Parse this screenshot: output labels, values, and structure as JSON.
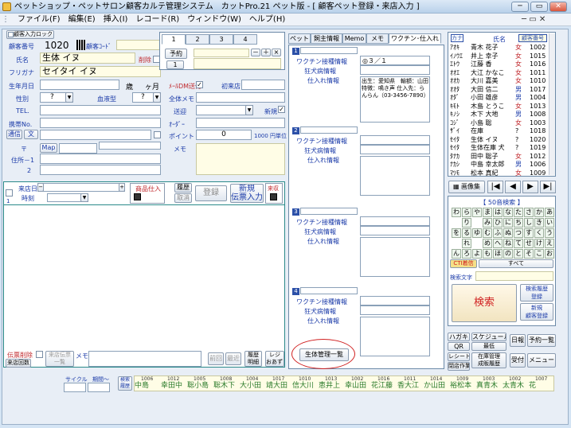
{
  "window": {
    "title": "ペットショップ・ペットサロン顧客カルテ管理システム　カットPro.21 ペット版 - [ 顧客ペット登録・来店入力 ]"
  },
  "menu": [
    "ファイル(F)",
    "編集(E)",
    "挿入(I)",
    "レコード(R)",
    "ウィンドウ(W)",
    "ヘルプ(H)"
  ],
  "customer": {
    "lock_label": "顧客入力ロック",
    "number_label": "顧客番号",
    "number_value": "1020",
    "code_label": "顧客ｺｰﾄﾞ",
    "name_label": "氏名",
    "name_value": "生体 イヌ",
    "delete_label": "削除",
    "furigana_label": "フリガナ",
    "furigana_value": "セイタイ イヌ",
    "birthday_label": "生年月日",
    "age_unit": "歳",
    "month_unit": "ヶ月",
    "dm_label": "ﾒｰﾙDM送付",
    "first_visit_label": "初来店",
    "sex_label": "性別",
    "sex_value": "?",
    "blood_label": "血液型",
    "blood_value": "?",
    "memo_label": "全体メモ",
    "tel_label": "TEL.",
    "send_label": "送迎",
    "new_label": "新規",
    "mobile_label": "携帯No.",
    "order_label": "ｵｰﾀﾞｰ",
    "mail_button": "通信",
    "text_button": "文",
    "point_label": "ポイント",
    "point_value": "0",
    "point_unit": "1000 円単位",
    "zip_label": "〒",
    "map_button": "Map",
    "memo2_label": "メモ",
    "address1_label": "住所－1",
    "address2_label": "2"
  },
  "tabs": {
    "items": [
      "1",
      "2",
      "3",
      "4"
    ],
    "reserve_button": "予約",
    "reserve_num": "1",
    "small_buttons": [
      "－",
      "＋",
      "×"
    ]
  },
  "visit": {
    "date_label": "来店日",
    "time_label": "時刻",
    "product_button": "商品仕入",
    "history_button": "履歴",
    "cancel_button": "取消",
    "register_button": "登録",
    "new_button_line1": "新規",
    "new_button_line2": "伝票入力",
    "receipt_button": "来収",
    "slip_delete": "伝票削除",
    "slip_list_line1": "来店伝票",
    "slip_list_line2": "一覧",
    "memo_label": "メモ",
    "visit_count_button": "来店回数",
    "prev_button": "前回",
    "recent_button": "最近",
    "detail_line1": "履歴",
    "detail_line2": "明細",
    "register_line1": "レジ",
    "register_line2": "おあずり"
  },
  "pet_tabs": [
    "ペット",
    "飼主情報",
    "Memo",
    "メモ",
    "ワクチン･仕入れ"
  ],
  "vaccine": {
    "sections": [
      {
        "num": "1",
        "vaccine_label": "ワクチン接種情報",
        "vaccine_value": "◎３／１",
        "disease_label": "狂犬病情報",
        "purchase_label": "仕入れ情報",
        "purchase_value": "出生：愛知県　輸額：山田 特徴：鳴き声 仕入先：らんらん（03-3456-7890）"
      },
      {
        "num": "2",
        "vaccine_label": "ワクチン接種情報",
        "vaccine_value": "",
        "disease_label": "狂犬病情報",
        "purchase_label": "仕入れ情報",
        "purchase_value": ""
      },
      {
        "num": "3",
        "vaccine_label": "ワクチン接種情報",
        "vaccine_value": "",
        "disease_label": "狂犬病情報",
        "purchase_label": "仕入れ情報",
        "purchase_value": ""
      },
      {
        "num": "4",
        "vaccine_label": "ワクチン接種情報",
        "vaccine_value": "",
        "disease_label": "狂犬病情報",
        "purchase_label": "仕入れ情報",
        "purchase_value": ""
      }
    ],
    "manage_button": "生体管理一覧"
  },
  "list": {
    "header": [
      "カナ",
      "氏名",
      "顧客番号"
    ],
    "rows": [
      {
        "kana": "ｱｵｷ",
        "name": "青木 花子",
        "sex": "女",
        "no": "1002"
      },
      {
        "kana": "ｲﾉｳｴ",
        "name": "井上 幸子",
        "sex": "女",
        "no": "1015"
      },
      {
        "kana": "ｴﾄｳ",
        "name": "江藤 香",
        "sex": "女",
        "no": "1016"
      },
      {
        "kana": "ｵｵｴ",
        "name": "大江 かなこ",
        "sex": "女",
        "no": "1011"
      },
      {
        "kana": "ｵｵｶ",
        "name": "大川 嘉美",
        "sex": "女",
        "no": "1010"
      },
      {
        "kana": "ｵｵﾀ",
        "name": "大田 信二",
        "sex": "男",
        "no": "1017"
      },
      {
        "kana": "ｵﾀﾞ",
        "name": "小田 雄彦",
        "sex": "男",
        "no": "1004"
      },
      {
        "kana": "ｷﾓﾄ",
        "name": "木島 とうこ",
        "sex": "女",
        "no": "1013"
      },
      {
        "kana": "ｷﾉｼ",
        "name": "木下 大地",
        "sex": "男",
        "no": "1008"
      },
      {
        "kana": "ｺｼﾞ",
        "name": "小島 聡",
        "sex": "女",
        "no": "1003"
      },
      {
        "kana": "ｻﾞｲ",
        "name": "在庫",
        "sex": "?",
        "no": "1018"
      },
      {
        "kana": "ｾｲﾀ",
        "name": "生体 イヌ",
        "sex": "?",
        "no": "1020"
      },
      {
        "kana": "ｾｲﾀ",
        "name": "生体在庫 犬",
        "sex": "?",
        "no": "1019"
      },
      {
        "kana": "ﾀﾅｶ",
        "name": "田中 聡子",
        "sex": "女",
        "no": "1012"
      },
      {
        "kana": "ﾅｶｼ",
        "name": "中島 幸太郎",
        "sex": "男",
        "no": "1006"
      },
      {
        "kana": "ﾏﾂﾓ",
        "name": "松本 真紀",
        "sex": "女",
        "no": "1009"
      }
    ],
    "image_button": "画像集",
    "search_header": "【 50音検索 】",
    "kana_grid": [
      [
        "わ",
        "ら",
        "や",
        "ま",
        "は",
        "な",
        "た",
        "さ",
        "か",
        "あ"
      ],
      [
        "",
        "り",
        "",
        "み",
        "ひ",
        "に",
        "ち",
        "し",
        "き",
        "い"
      ],
      [
        "を",
        "る",
        "ゆ",
        "む",
        "ふ",
        "ぬ",
        "つ",
        "す",
        "く",
        "う"
      ],
      [
        "",
        "れ",
        "",
        "め",
        "へ",
        "ね",
        "て",
        "せ",
        "け",
        "え"
      ],
      [
        "ん",
        "ろ",
        "よ",
        "も",
        "ほ",
        "の",
        "と",
        "そ",
        "こ",
        "お"
      ]
    ],
    "cti_button": "CTI着信",
    "all_button": "すべて",
    "search_label": "検索文字",
    "search_button": "検索",
    "history_search_line1": "検索履歴",
    "history_search_line2": "登録",
    "new_customer_line1": "新規",
    "new_customer_line2": "顧客登録"
  },
  "bottom_buttons": {
    "postcard": "ハガキ",
    "schedule": "スケジュール",
    "daily": "日報",
    "reserve_list": "予約一覧",
    "qr": "QR",
    "qr_sub": "最低",
    "receipt": "レシート",
    "stock_line1": "在庫管理",
    "stock_line2": "成販履歴",
    "receive": "受付",
    "menu": "メニュー",
    "close": "閉店作業"
  },
  "strip": {
    "cycle_label": "サイクル",
    "period_label": "期間～",
    "search_btn_line1": "検索",
    "search_btn_line2": "履歴",
    "entries": [
      {
        "no": "1006",
        "name": "中島"
      },
      {
        "no": "1012",
        "name": "幸田中"
      },
      {
        "no": "1005",
        "name": "聡小島"
      },
      {
        "no": "1008",
        "name": "聡木下"
      },
      {
        "no": "1004",
        "name": "大小田"
      },
      {
        "no": "1017",
        "name": "靖大田"
      },
      {
        "no": "1010",
        "name": "信大川"
      },
      {
        "no": "1013",
        "name": "恵井上"
      },
      {
        "no": "1002",
        "name": "幸山田"
      },
      {
        "no": "1016",
        "name": "花江藤"
      },
      {
        "no": "1011",
        "name": "香大江"
      },
      {
        "no": "1014",
        "name": "か山田"
      },
      {
        "no": "1009",
        "name": "裕松本"
      },
      {
        "no": "1003",
        "name": "真青木"
      },
      {
        "no": "1002",
        "name": "太青木"
      },
      {
        "no": "1007",
        "name": "花"
      }
    ]
  },
  "colors": {
    "male": "#1a3aa8",
    "female": "#c0282c",
    "accent": "#2c50a8",
    "circle": "#d02020"
  }
}
